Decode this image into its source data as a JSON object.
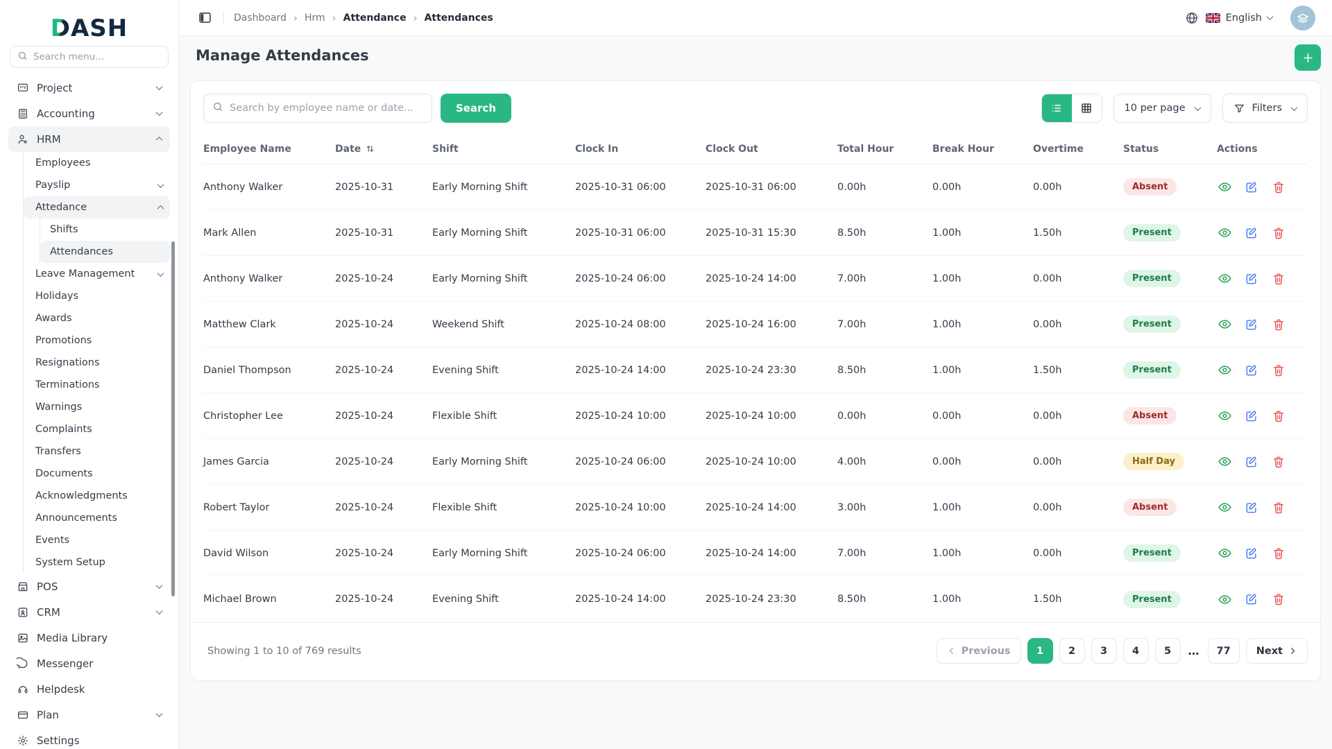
{
  "brand": {
    "logo_first": "D",
    "logo_rest": "ASH"
  },
  "sidebar": {
    "search_placeholder": "Search menu...",
    "items": [
      {
        "label": "Project"
      },
      {
        "label": "Accounting"
      },
      {
        "label": "HRM"
      },
      {
        "label": "Employees"
      },
      {
        "label": "Payslip"
      },
      {
        "label": "Attedance"
      },
      {
        "label": "Shifts"
      },
      {
        "label": "Attendances"
      },
      {
        "label": "Leave Management"
      },
      {
        "label": "Holidays"
      },
      {
        "label": "Awards"
      },
      {
        "label": "Promotions"
      },
      {
        "label": "Resignations"
      },
      {
        "label": "Terminations"
      },
      {
        "label": "Warnings"
      },
      {
        "label": "Complaints"
      },
      {
        "label": "Transfers"
      },
      {
        "label": "Documents"
      },
      {
        "label": "Acknowledgments"
      },
      {
        "label": "Announcements"
      },
      {
        "label": "Events"
      },
      {
        "label": "System Setup"
      },
      {
        "label": "POS"
      },
      {
        "label": "CRM"
      },
      {
        "label": "Media Library"
      },
      {
        "label": "Messenger"
      },
      {
        "label": "Helpdesk"
      },
      {
        "label": "Plan"
      },
      {
        "label": "Settings"
      }
    ]
  },
  "topbar": {
    "separator": "›",
    "breadcrumbs": {
      "0": "Dashboard",
      "1": "Hrm",
      "2": "Attendance",
      "3": "Attendances"
    },
    "language": "English"
  },
  "page": {
    "title": "Manage Attendances"
  },
  "toolbar": {
    "search_placeholder": "Search by employee name or date...",
    "search_button": "Search",
    "per_page": "10 per page",
    "filters_label": "Filters"
  },
  "table": {
    "headers": {
      "employee": "Employee Name",
      "date": "Date",
      "shift": "Shift",
      "clock_in": "Clock In",
      "clock_out": "Clock Out",
      "total_hour": "Total Hour",
      "break_hour": "Break Hour",
      "overtime": "Overtime",
      "status": "Status",
      "actions": "Actions"
    },
    "rows": [
      {
        "employee": "Anthony Walker",
        "date": "2025-10-31",
        "shift": "Early Morning Shift",
        "clock_in": "2025-10-31 06:00",
        "clock_out": "2025-10-31 06:00",
        "total_hour": "0.00h",
        "break_hour": "0.00h",
        "overtime": "0.00h",
        "status": "Absent"
      },
      {
        "employee": "Mark Allen",
        "date": "2025-10-31",
        "shift": "Early Morning Shift",
        "clock_in": "2025-10-31 06:00",
        "clock_out": "2025-10-31 15:30",
        "total_hour": "8.50h",
        "break_hour": "1.00h",
        "overtime": "1.50h",
        "status": "Present"
      },
      {
        "employee": "Anthony Walker",
        "date": "2025-10-24",
        "shift": "Early Morning Shift",
        "clock_in": "2025-10-24 06:00",
        "clock_out": "2025-10-24 14:00",
        "total_hour": "7.00h",
        "break_hour": "1.00h",
        "overtime": "0.00h",
        "status": "Present"
      },
      {
        "employee": "Matthew Clark",
        "date": "2025-10-24",
        "shift": "Weekend Shift",
        "clock_in": "2025-10-24 08:00",
        "clock_out": "2025-10-24 16:00",
        "total_hour": "7.00h",
        "break_hour": "1.00h",
        "overtime": "0.00h",
        "status": "Present"
      },
      {
        "employee": "Daniel Thompson",
        "date": "2025-10-24",
        "shift": "Evening Shift",
        "clock_in": "2025-10-24 14:00",
        "clock_out": "2025-10-24 23:30",
        "total_hour": "8.50h",
        "break_hour": "1.00h",
        "overtime": "1.50h",
        "status": "Present"
      },
      {
        "employee": "Christopher Lee",
        "date": "2025-10-24",
        "shift": "Flexible Shift",
        "clock_in": "2025-10-24 10:00",
        "clock_out": "2025-10-24 10:00",
        "total_hour": "0.00h",
        "break_hour": "0.00h",
        "overtime": "0.00h",
        "status": "Absent"
      },
      {
        "employee": "James Garcia",
        "date": "2025-10-24",
        "shift": "Early Morning Shift",
        "clock_in": "2025-10-24 06:00",
        "clock_out": "2025-10-24 10:00",
        "total_hour": "4.00h",
        "break_hour": "0.00h",
        "overtime": "0.00h",
        "status": "Half Day"
      },
      {
        "employee": "Robert Taylor",
        "date": "2025-10-24",
        "shift": "Flexible Shift",
        "clock_in": "2025-10-24 10:00",
        "clock_out": "2025-10-24 14:00",
        "total_hour": "3.00h",
        "break_hour": "1.00h",
        "overtime": "0.00h",
        "status": "Absent"
      },
      {
        "employee": "David Wilson",
        "date": "2025-10-24",
        "shift": "Early Morning Shift",
        "clock_in": "2025-10-24 06:00",
        "clock_out": "2025-10-24 14:00",
        "total_hour": "7.00h",
        "break_hour": "1.00h",
        "overtime": "0.00h",
        "status": "Present"
      },
      {
        "employee": "Michael Brown",
        "date": "2025-10-24",
        "shift": "Evening Shift",
        "clock_in": "2025-10-24 14:00",
        "clock_out": "2025-10-24 23:30",
        "total_hour": "8.50h",
        "break_hour": "1.00h",
        "overtime": "1.50h",
        "status": "Present"
      }
    ]
  },
  "pagination": {
    "summary": "Showing 1 to 10 of 769 results",
    "previous": "Previous",
    "next": "Next",
    "pages": {
      "0": "1",
      "1": "2",
      "2": "3",
      "3": "4",
      "4": "5",
      "last": "77"
    },
    "ellipsis": "…",
    "active_page": "1"
  },
  "colors": {
    "accent_green": "#29b784",
    "status_present_bg": "#def5e8",
    "status_present_text": "#1d7c48",
    "status_absent_bg": "#fbe6e6",
    "status_absent_text": "#a02a2a",
    "status_halfday_bg": "#fcf0cb",
    "status_halfday_text": "#8c6a14",
    "avatar_bg": "#a3c3d6"
  }
}
